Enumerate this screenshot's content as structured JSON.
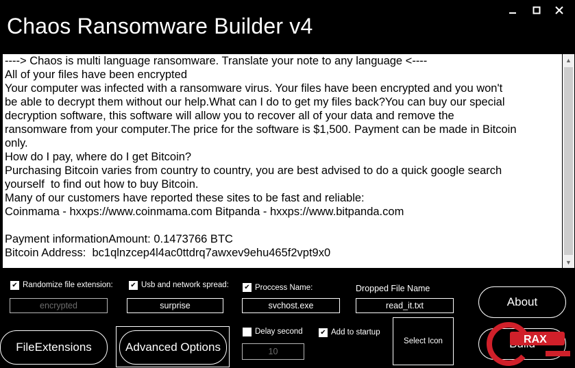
{
  "window": {
    "title": "Chaos Ransomware Builder v4",
    "minimize_icon": "minimize-icon",
    "maximize_icon": "maximize-icon",
    "close_icon": "close-icon"
  },
  "note": {
    "lines": [
      "----> Chaos is multi language ransomware. Translate your note to any language <----",
      "All of your files have been encrypted",
      "Your computer was infected with a ransomware virus. Your files have been encrypted and you won't",
      "be able to decrypt them without our help.What can I do to get my files back?You can buy our special",
      "decryption software, this software will allow you to recover all of your data and remove the",
      "ransomware from your computer.The price for the software is $1,500. Payment can be made in Bitcoin",
      "only.",
      "How do I pay, where do I get Bitcoin?",
      "Purchasing Bitcoin varies from country to country, you are best advised to do a quick google search",
      "yourself  to find out how to buy Bitcoin.",
      "Many of our customers have reported these sites to be fast and reliable:",
      "Coinmama - hxxps://www.coinmama.com Bitpanda - hxxps://www.bitpanda.com",
      "",
      "Payment informationAmount: 0.1473766 BTC",
      "Bitcoin Address:  bc1qlnzcep4l4ac0ttdrq7awxev9ehu465f2vpt9x0"
    ]
  },
  "options": {
    "randomize_ext": {
      "label": "Randomize file extension:",
      "checked": true,
      "value": "encrypted"
    },
    "usb_spread": {
      "label": "Usb and network spread:",
      "checked": true,
      "value": "surprise"
    },
    "process_name": {
      "label": "Proccess Name:",
      "checked": true,
      "value": "svchost.exe"
    },
    "dropped_file": {
      "label": "Dropped File Name",
      "value": "read_it.txt"
    },
    "delay": {
      "label": "Delay second",
      "checked": false,
      "value": "10"
    },
    "startup": {
      "label": "Add to startup",
      "checked": true
    }
  },
  "buttons": {
    "file_extensions": "FileExtensions",
    "advanced_options": "Advanced Options",
    "about": "About",
    "build": "Build",
    "select_icon": "Select Icon"
  },
  "colors": {
    "background": "#000000",
    "text": "#ffffff",
    "note_bg": "#ffffff",
    "watermark_red": "#d0202a"
  }
}
